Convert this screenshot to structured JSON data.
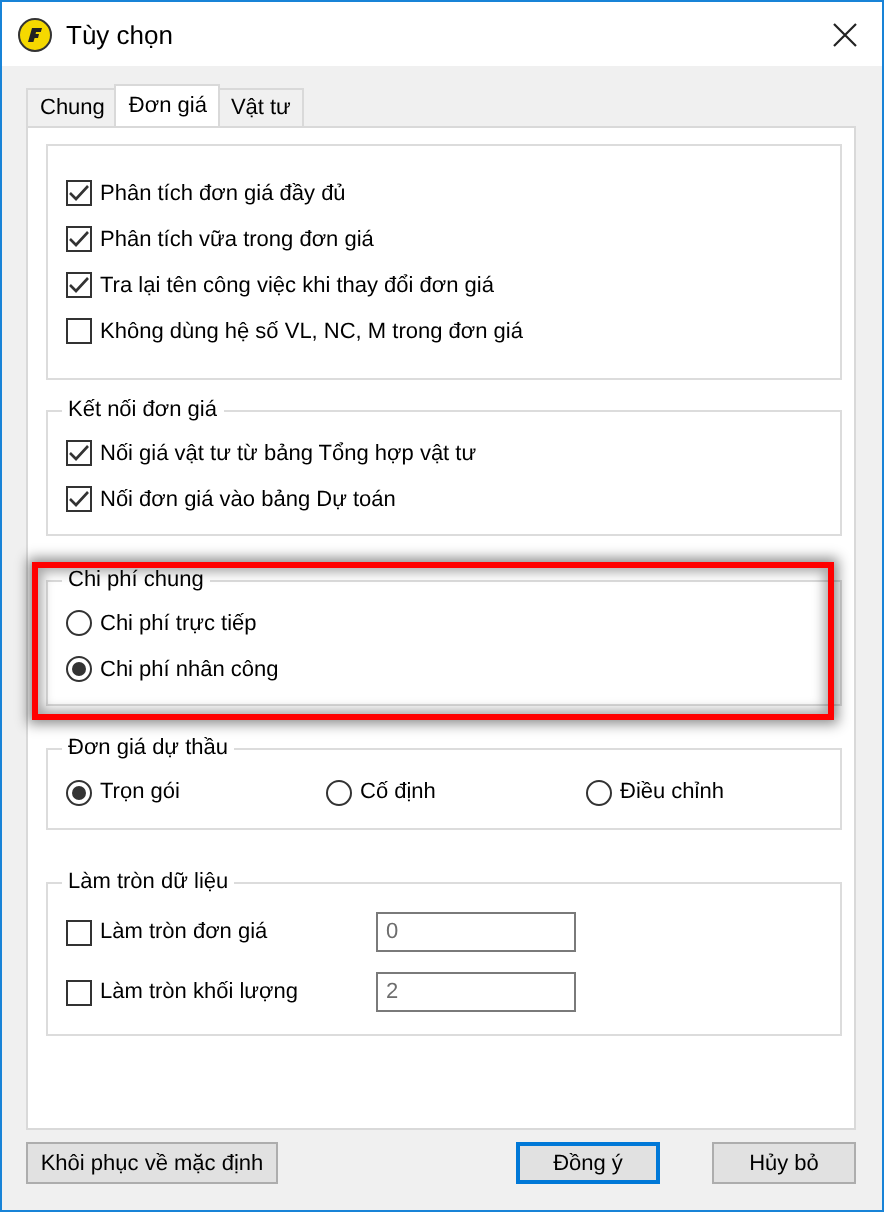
{
  "window": {
    "title": "Tùy chọn"
  },
  "tabs": [
    {
      "label": "Chung",
      "selected": false
    },
    {
      "label": "Đơn giá",
      "selected": true
    },
    {
      "label": "Vật tư",
      "selected": false
    }
  ],
  "groups": [
    {
      "kind": "checks",
      "highlighted": false,
      "items": [
        {
          "label": "Phân tích đơn giá đầy đủ",
          "checked": true
        },
        {
          "label": "Phân tích vữa trong đơn giá",
          "checked": true
        },
        {
          "label": "Tra lại tên công việc khi thay đổi đơn giá",
          "checked": true
        },
        {
          "label": "Không dùng hệ số VL, NC, M trong đơn giá",
          "checked": false
        }
      ]
    },
    {
      "kind": "checks",
      "title": "Kết nối đơn giá",
      "highlighted": false,
      "items": [
        {
          "label": "Nối giá vật tư từ bảng Tổng hợp vật tư",
          "checked": true
        },
        {
          "label": "Nối đơn giá vào bảng Dự toán",
          "checked": true
        }
      ]
    },
    {
      "kind": "radios",
      "title": "Chi phí chung",
      "highlighted": true,
      "items": [
        {
          "label": "Chi phí trực tiếp",
          "selected": false
        },
        {
          "label": "Chi phí nhân công",
          "selected": true
        }
      ]
    },
    {
      "kind": "radio-row",
      "title": "Đơn giá dự thầu",
      "highlighted": false,
      "items": [
        {
          "label": "Trọn gói",
          "selected": true
        },
        {
          "label": "Cố định",
          "selected": false
        },
        {
          "label": "Điều chỉnh",
          "selected": false
        }
      ]
    },
    {
      "kind": "rounding",
      "title": "Làm tròn dữ liệu",
      "highlighted": false,
      "items": [
        {
          "label": "Làm tròn đơn giá",
          "checked": false,
          "value": "0"
        },
        {
          "label": "Làm tròn khối lượng",
          "checked": false,
          "value": "2"
        }
      ]
    }
  ],
  "buttons": [
    {
      "label": "Khôi phục về mặc định",
      "focused": false
    },
    {
      "label": "Đồng ý",
      "focused": true
    },
    {
      "label": "Hủy bỏ",
      "focused": false
    }
  ]
}
